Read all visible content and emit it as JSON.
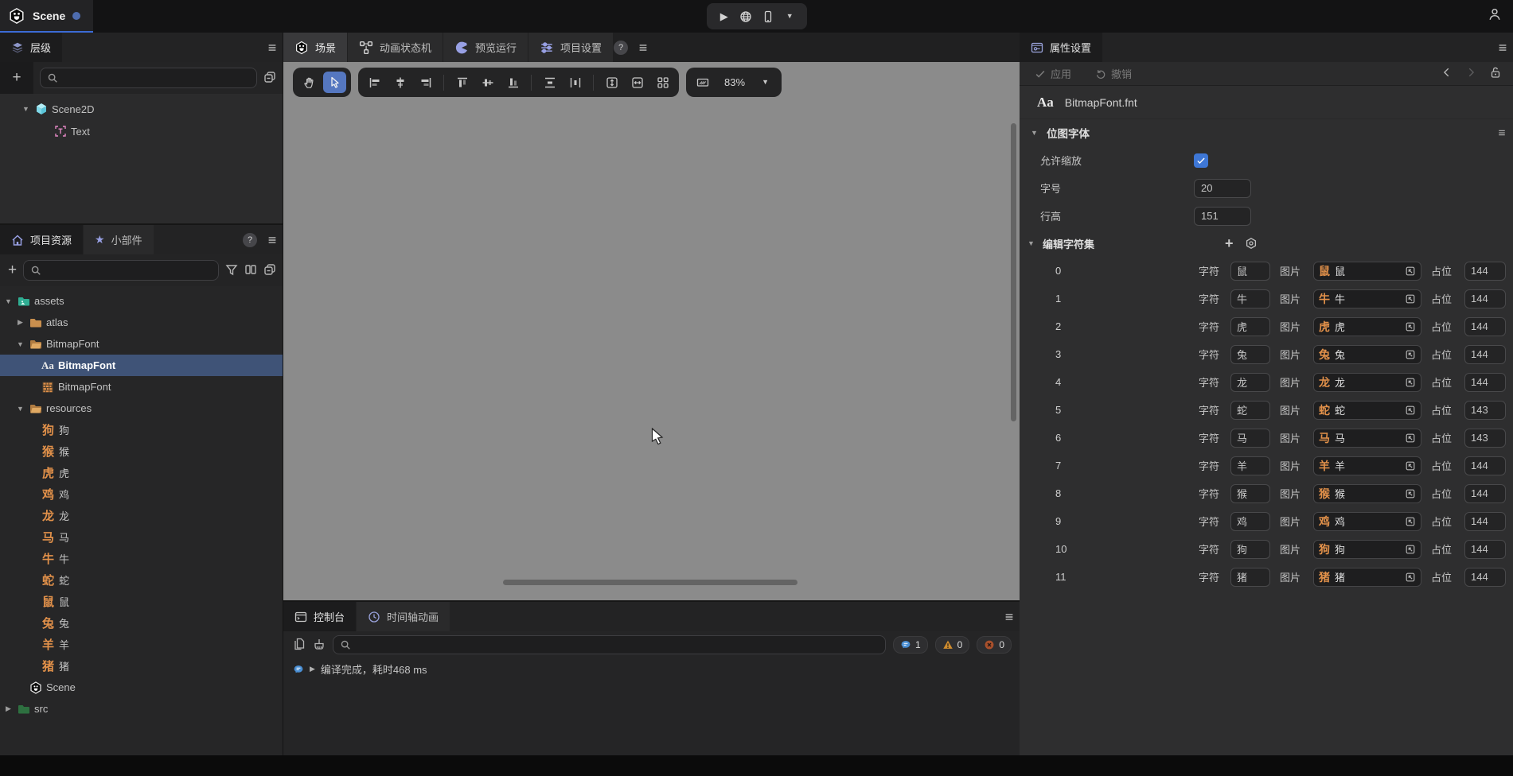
{
  "topbar": {
    "window_tab": "Scene"
  },
  "hierarchy": {
    "tab_label": "层级",
    "nodes": [
      {
        "label": "Scene2D",
        "icon": "cube",
        "expander": "▼",
        "indent": 0
      },
      {
        "label": "Text",
        "icon": "text-node",
        "expander": "",
        "indent": 1
      }
    ]
  },
  "assets": {
    "tab_project_label": "项目资源",
    "tab_widgets_label": "小部件",
    "tree": [
      {
        "label": "assets",
        "icon": "folder-assets",
        "expander": "▼",
        "indent": 0
      },
      {
        "label": "atlas",
        "icon": "folder",
        "expander": "▶",
        "indent": 1
      },
      {
        "label": "BitmapFont",
        "icon": "folder-open",
        "expander": "▼",
        "indent": 1
      },
      {
        "label": "BitmapFont",
        "icon": "font-file",
        "expander": "",
        "indent": 2,
        "selected": true
      },
      {
        "label": "BitmapFont",
        "icon": "bitmap-file",
        "expander": "",
        "indent": 2
      },
      {
        "label": "resources",
        "icon": "folder-open",
        "expander": "▼",
        "indent": 1
      },
      {
        "label": "狗",
        "icon_char": "狗",
        "expander": "",
        "indent": 2
      },
      {
        "label": "猴",
        "icon_char": "猴",
        "expander": "",
        "indent": 2
      },
      {
        "label": "虎",
        "icon_char": "虎",
        "expander": "",
        "indent": 2
      },
      {
        "label": "鸡",
        "icon_char": "鸡",
        "expander": "",
        "indent": 2
      },
      {
        "label": "龙",
        "icon_char": "龙",
        "expander": "",
        "indent": 2
      },
      {
        "label": "马",
        "icon_char": "马",
        "expander": "",
        "indent": 2
      },
      {
        "label": "牛",
        "icon_char": "牛",
        "expander": "",
        "indent": 2
      },
      {
        "label": "蛇",
        "icon_char": "蛇",
        "expander": "",
        "indent": 2
      },
      {
        "label": "鼠",
        "icon_char": "鼠",
        "expander": "",
        "indent": 2
      },
      {
        "label": "兔",
        "icon_char": "兔",
        "expander": "",
        "indent": 2
      },
      {
        "label": "羊",
        "icon_char": "羊",
        "expander": "",
        "indent": 2
      },
      {
        "label": "猪",
        "icon_char": "猪",
        "expander": "",
        "indent": 2
      },
      {
        "label": "Scene",
        "icon": "scene-file",
        "expander": "",
        "indent": 1
      },
      {
        "label": "src",
        "icon": "folder-src",
        "expander": "▶",
        "indent": 0
      }
    ]
  },
  "scene_view": {
    "tabs": [
      {
        "label": "场景",
        "icon": "scene-logo",
        "active": true
      },
      {
        "label": "动画状态机",
        "icon": "state-machine",
        "active": false
      },
      {
        "label": "预览运行",
        "icon": "preview-run",
        "active": false
      },
      {
        "label": "项目设置",
        "icon": "project-settings",
        "active": false
      }
    ],
    "zoom_value": "83%"
  },
  "console": {
    "tab_console_label": "控制台",
    "tab_timeline_label": "时间轴动画",
    "info_count": "1",
    "warning_count": "0",
    "error_count": "0",
    "log_message": "编译完成，耗时468 ms"
  },
  "properties": {
    "tab_label": "属性设置",
    "apply_label": "应用",
    "undo_label": "撤销",
    "file_name": "BitmapFont.fnt",
    "section_title": "位图字体",
    "allow_scale_label": "允许缩放",
    "allow_scale_checked": true,
    "font_size_label": "字号",
    "font_size_value": "20",
    "line_height_label": "行高",
    "line_height_value": "151",
    "charset_label": "编辑字符集",
    "col_char_label": "字符",
    "col_image_label": "图片",
    "col_placeholder_label": "占位",
    "charset_rows": [
      {
        "index": "0",
        "char": "鼠",
        "image_name": "鼠",
        "placeholder": "144"
      },
      {
        "index": "1",
        "char": "牛",
        "image_name": "牛",
        "placeholder": "144"
      },
      {
        "index": "2",
        "char": "虎",
        "image_name": "虎",
        "placeholder": "144"
      },
      {
        "index": "3",
        "char": "兔",
        "image_name": "兔",
        "placeholder": "144"
      },
      {
        "index": "4",
        "char": "龙",
        "image_name": "龙",
        "placeholder": "144"
      },
      {
        "index": "5",
        "char": "蛇",
        "image_name": "蛇",
        "placeholder": "143"
      },
      {
        "index": "6",
        "char": "马",
        "image_name": "马",
        "placeholder": "143"
      },
      {
        "index": "7",
        "char": "羊",
        "image_name": "羊",
        "placeholder": "144"
      },
      {
        "index": "8",
        "char": "猴",
        "image_name": "猴",
        "placeholder": "144"
      },
      {
        "index": "9",
        "char": "鸡",
        "image_name": "鸡",
        "placeholder": "144"
      },
      {
        "index": "10",
        "char": "狗",
        "image_name": "狗",
        "placeholder": "144"
      },
      {
        "index": "11",
        "char": "猪",
        "image_name": "猪",
        "placeholder": "144"
      }
    ]
  },
  "colors": {
    "accent_blue": "#5577c0",
    "checkbox_blue": "#3e77d6",
    "zodiac_orange": "#e2914a",
    "selected_row_blue": "#3f5377",
    "canvas_gray": "#8b8b8b",
    "info_blue": "#4a8fd4",
    "warning_orange": "#cf8c2e",
    "error_red": "#a8502c"
  }
}
